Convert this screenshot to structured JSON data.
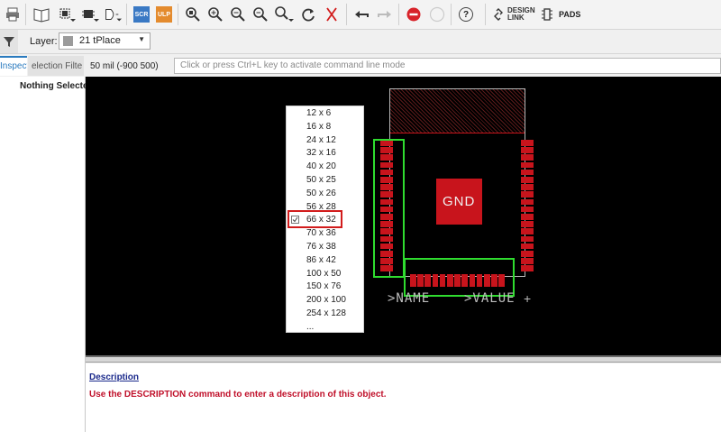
{
  "toolbar": {
    "scr_label": "SCR",
    "ulp_label": "ULP",
    "design_link_label": "DESIGN\nLINK",
    "pads_label": "PADS",
    "help_label": "?"
  },
  "layerbar": {
    "layer_label": "Layer:",
    "layer_value": "21 tPlace"
  },
  "panel": {
    "tabs": [
      "Inspecto",
      "election Filte"
    ],
    "nothing_selected": "Nothing Selecte"
  },
  "command": {
    "coordinates": "50 mil (-900 500)",
    "placeholder": "Click or press Ctrl+L key to activate command line mode"
  },
  "menu": {
    "items": [
      "12 x 6",
      "16 x 8",
      "24 x 12",
      "32 x 16",
      "40 x 20",
      "50 x 25",
      "50 x 26",
      "56 x 28",
      "66 x 32",
      "70 x 36",
      "76 x 38",
      "86 x 42",
      "100 x 50",
      "150 x 76",
      "200 x 100",
      "254 x 128",
      "..."
    ],
    "selected_index": 8
  },
  "canvas": {
    "pad_label": "GND",
    "name_label": ">NAME",
    "value_label": ">VALUE"
  },
  "description": {
    "title": "Description",
    "text": "Use the DESCRIPTION command to enter a description of this object."
  },
  "colors": {
    "pad": "#c8141c",
    "highlight": "#2fdc2f",
    "selection_box": "#d21c1c",
    "accent_tab": "#2b7bbf"
  }
}
